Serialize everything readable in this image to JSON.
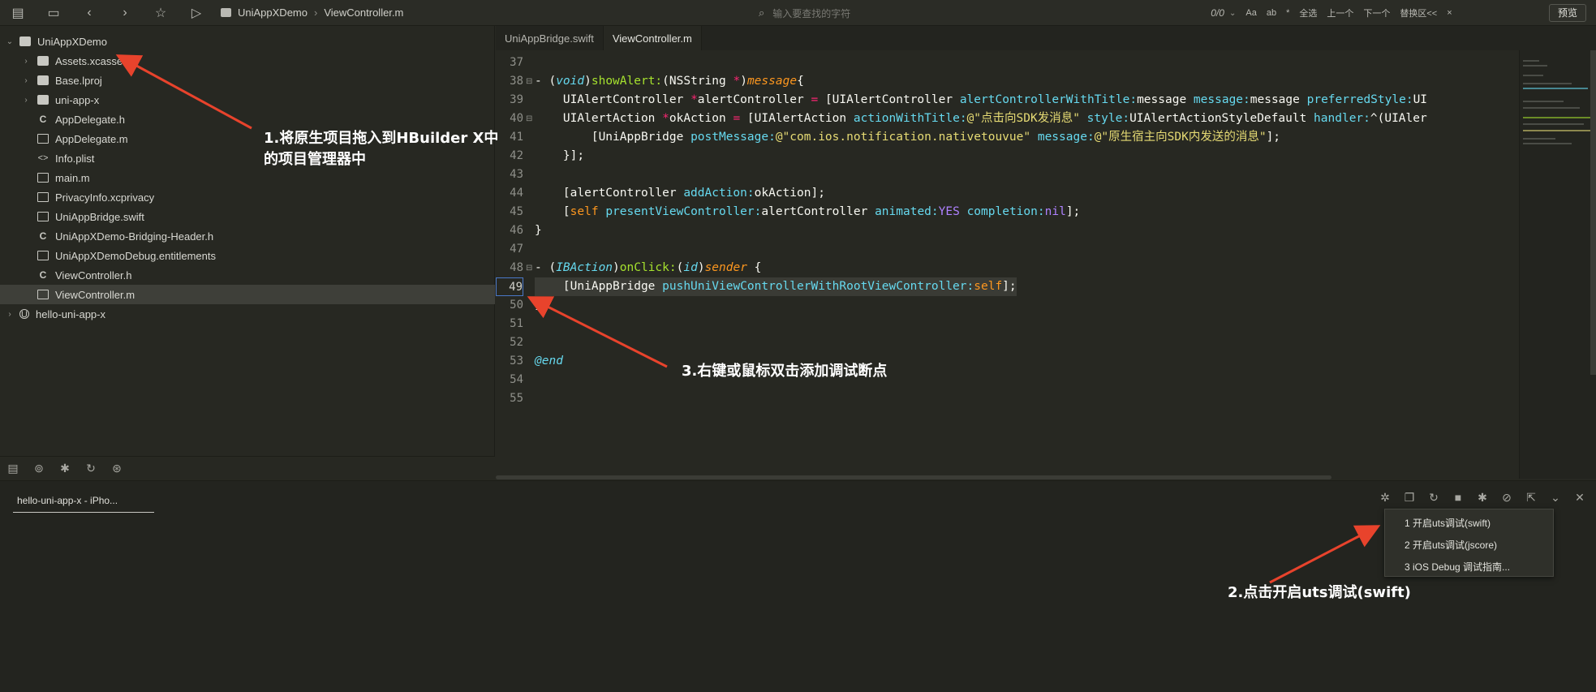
{
  "toolbar": {
    "breadcrumb": [
      "UniAppXDemo",
      "ViewController.m"
    ],
    "find_placeholder": "输入要查找的字符",
    "find_count": "0/0",
    "find_options": [
      "Aa",
      "ab",
      "*",
      "全选",
      "上一个",
      "下一个",
      "替换区<<",
      "×"
    ],
    "preview_label": "预览"
  },
  "sidebar": {
    "items": [
      {
        "label": "UniAppXDemo",
        "icon": "folder-icon",
        "chevron": "⌄"
      },
      {
        "label": "Assets.xcassets",
        "icon": "folder-icon",
        "chevron": "›"
      },
      {
        "label": "Base.lproj",
        "icon": "folder-icon",
        "chevron": "›"
      },
      {
        "label": "uni-app-x",
        "icon": "folder-icon",
        "chevron": "›"
      },
      {
        "label": "AppDelegate.h",
        "icon": "c-file-icon",
        "chevron": ""
      },
      {
        "label": "AppDelegate.m",
        "icon": "file-icon",
        "chevron": ""
      },
      {
        "label": "Info.plist",
        "icon": "code-file-icon",
        "chevron": ""
      },
      {
        "label": "main.m",
        "icon": "file-icon",
        "chevron": ""
      },
      {
        "label": "PrivacyInfo.xcprivacy",
        "icon": "file-icon",
        "chevron": ""
      },
      {
        "label": "UniAppBridge.swift",
        "icon": "file-icon",
        "chevron": ""
      },
      {
        "label": "UniAppXDemo-Bridging-Header.h",
        "icon": "c-file-icon",
        "chevron": ""
      },
      {
        "label": "UniAppXDemoDebug.entitlements",
        "icon": "file-icon",
        "chevron": ""
      },
      {
        "label": "ViewController.h",
        "icon": "c-file-icon",
        "chevron": ""
      },
      {
        "label": "ViewController.m",
        "icon": "file-icon",
        "chevron": ""
      },
      {
        "label": "hello-uni-app-x",
        "icon": "project-icon",
        "chevron": "›"
      }
    ]
  },
  "editor": {
    "tabs": [
      "UniAppBridge.swift",
      "ViewController.m"
    ],
    "line_numbers": [
      "37",
      "38",
      "39",
      "40",
      "41",
      "42",
      "43",
      "44",
      "45",
      "46",
      "47",
      "48",
      "49",
      "50",
      "51",
      "52",
      "53",
      "54",
      "55"
    ],
    "code": {
      "l38": [
        "- (",
        "void",
        ")",
        "showAlert:",
        "(NSString ",
        "*",
        ")",
        "message",
        "{"
      ],
      "l39": [
        "    UIAlertController ",
        "*",
        "alertController ",
        "=",
        " [UIAlertController ",
        "alertControllerWithTitle:",
        "message ",
        "message:",
        "message ",
        "preferredStyle:",
        "UI"
      ],
      "l40": [
        "    UIAlertAction ",
        "*",
        "okAction ",
        "=",
        " [UIAlertAction ",
        "actionWithTitle:",
        "@\"点击向SDK发消息\"",
        " style:",
        "UIAlertActionStyleDefault ",
        "handler:",
        "^(UIAler"
      ],
      "l41": [
        "        [UniAppBridge ",
        "postMessage:",
        "@\"com.ios.notification.nativetouvue\"",
        " message:",
        "@\"原生宿主向SDK内发送的消息\"",
        "];"
      ],
      "l42": "    }];",
      "l44": [
        "    [alertController ",
        "addAction:",
        "okAction];"
      ],
      "l45": [
        "    [",
        "self",
        " ",
        "presentViewController:",
        "alertController ",
        "animated:",
        "YES",
        " ",
        "completion:",
        "nil",
        "];"
      ],
      "l46": "}",
      "l48": [
        "- (",
        "IBAction",
        ")",
        "onClick:",
        "(",
        "id",
        ")",
        "sender",
        " {"
      ],
      "l49": [
        "    [UniAppBridge ",
        "pushUniViewControllerWithRootViewController:",
        "self",
        "];"
      ],
      "l50": "}",
      "l54": "@end"
    }
  },
  "bottom": {
    "console_tab": "hello-uni-app-x - iPho...",
    "menu": [
      "1 开启uts调试(swift)",
      "2 开启uts调试(jscore)",
      "3 iOS Debug 调试指南..."
    ]
  },
  "annotations": {
    "a1_line1": "1.将原生项目拖入到HBuilder X中",
    "a1_line2": "的项目管理器中",
    "a2": "2.点击开启uts调试(swift)",
    "a3": "3.右键或鼠标双击添加调试断点",
    "arrow_color": "#e8432c"
  }
}
